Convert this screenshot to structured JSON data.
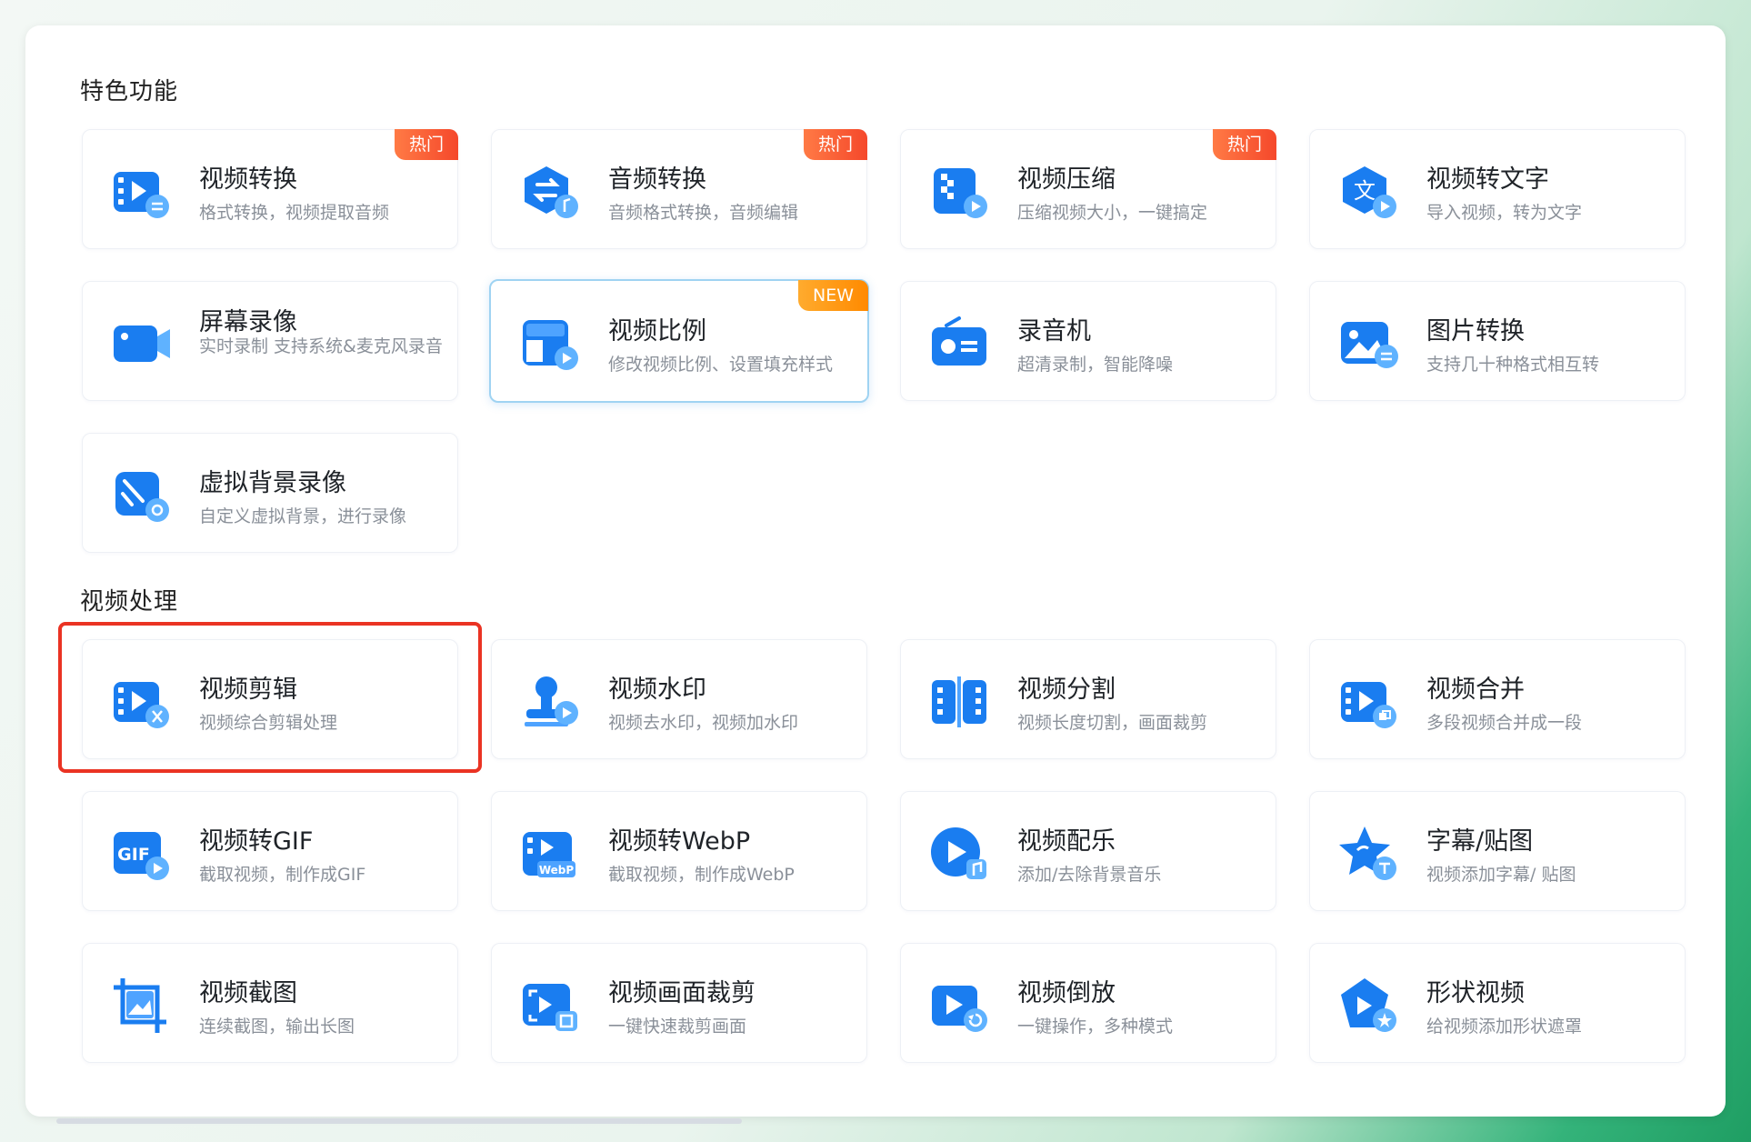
{
  "sections": {
    "featured": {
      "title": "特色功能"
    },
    "video": {
      "title": "视频处理"
    }
  },
  "colors": {
    "accent": "#1a7df0",
    "hot_badge": "#f5482b",
    "new_badge": "#ff8a00",
    "highlight": "#ea3323"
  },
  "featured_cards": [
    {
      "title": "视频转换",
      "desc": "格式转换，视频提取音频",
      "badge": "热门",
      "icon": "video-convert-icon"
    },
    {
      "title": "音频转换",
      "desc": "音频格式转换，音频编辑",
      "badge": "热门",
      "icon": "audio-convert-icon"
    },
    {
      "title": "视频压缩",
      "desc": "压缩视频大小，一键搞定",
      "badge": "热门",
      "icon": "video-compress-icon"
    },
    {
      "title": "视频转文字",
      "desc": "导入视频，转为文字",
      "badge": "",
      "icon": "video-to-text-icon"
    },
    {
      "title": "屏幕录像",
      "desc": "实时录制 支持系统&麦克风录音",
      "badge": "",
      "icon": "screen-record-icon"
    },
    {
      "title": "视频比例",
      "desc": "修改视频比例、设置填充样式",
      "badge": "NEW",
      "icon": "video-ratio-icon"
    },
    {
      "title": "录音机",
      "desc": "超清录制，智能降噪",
      "badge": "",
      "icon": "recorder-icon"
    },
    {
      "title": "图片转换",
      "desc": "支持几十种格式相互转",
      "badge": "",
      "icon": "image-convert-icon"
    },
    {
      "title": "虚拟背景录像",
      "desc": "自定义虚拟背景，进行录像",
      "badge": "",
      "icon": "virtual-background-icon"
    }
  ],
  "video_cards": [
    {
      "title": "视频剪辑",
      "desc": "视频综合剪辑处理",
      "icon": "video-edit-icon"
    },
    {
      "title": "视频水印",
      "desc": "视频去水印，视频加水印",
      "icon": "video-watermark-icon"
    },
    {
      "title": "视频分割",
      "desc": "视频长度切割，画面裁剪",
      "icon": "video-split-icon"
    },
    {
      "title": "视频合并",
      "desc": "多段视频合并成一段",
      "icon": "video-merge-icon"
    },
    {
      "title": "视频转GIF",
      "desc": "截取视频，制作成GIF",
      "icon": "video-to-gif-icon"
    },
    {
      "title": "视频转WebP",
      "desc": "截取视频，制作成WebP",
      "icon": "video-to-webp-icon"
    },
    {
      "title": "视频配乐",
      "desc": "添加/去除背景音乐",
      "icon": "video-music-icon"
    },
    {
      "title": "字幕/贴图",
      "desc": "视频添加字幕/ 贴图",
      "icon": "subtitle-sticker-icon"
    },
    {
      "title": "视频截图",
      "desc": "连续截图，输出长图",
      "icon": "video-screenshot-icon"
    },
    {
      "title": "视频画面裁剪",
      "desc": "一键快速裁剪画面",
      "icon": "video-crop-icon"
    },
    {
      "title": "视频倒放",
      "desc": "一键操作，多种模式",
      "icon": "video-reverse-icon"
    },
    {
      "title": "形状视频",
      "desc": "给视频添加形状遮罩",
      "icon": "shape-video-icon"
    }
  ]
}
